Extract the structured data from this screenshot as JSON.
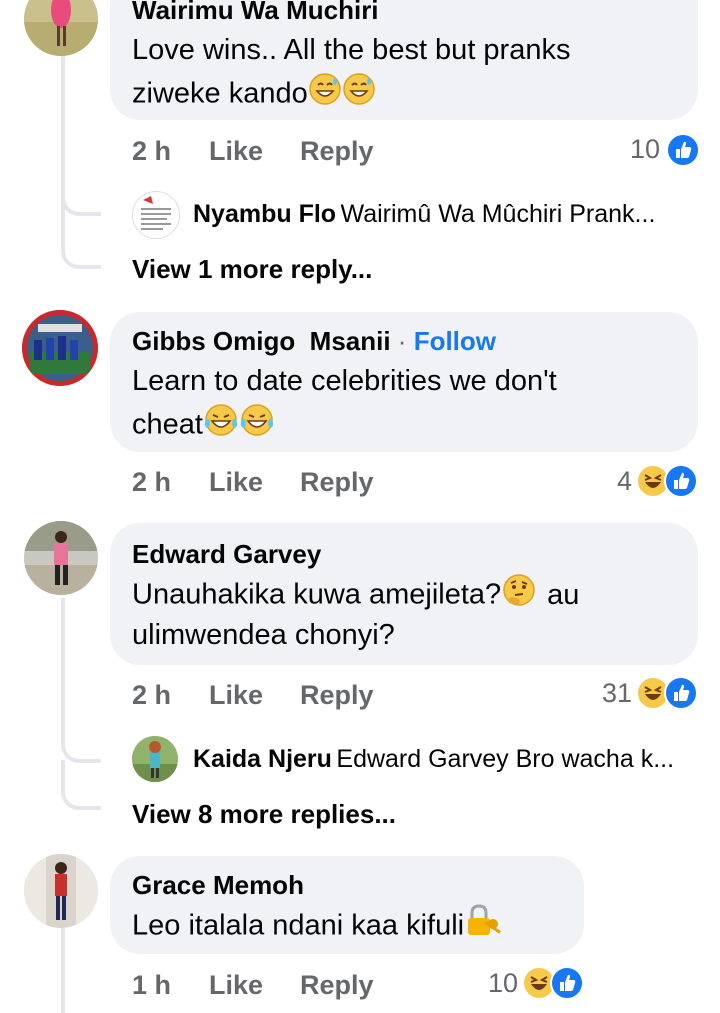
{
  "comments": [
    {
      "name": "Wairimu Wa Muchiri",
      "line1": "Love wins.. All the best but pranks",
      "line2": "ziweke kando",
      "time": "2 h",
      "like": "Like",
      "reply": "Reply",
      "count": "10",
      "reply_preview": {
        "name": "Nyambu Flo",
        "text": "Wairimû Wa Mûchiri Prank..."
      },
      "more": "View 1 more reply..."
    },
    {
      "name": "Gibbs Omigo  Msanii",
      "follow": "Follow",
      "line1": "Learn to date celebrities we don't",
      "line2": "cheat",
      "time": "2 h",
      "like": "Like",
      "reply": "Reply",
      "count": "4"
    },
    {
      "name": "Edward Garvey",
      "line1": "Unauhakika kuwa amejileta?",
      "line1b": "au",
      "line2": "ulimwendea chonyi?",
      "time": "2 h",
      "like": "Like",
      "reply": "Reply",
      "count": "31",
      "reply_preview": {
        "name": "Kaida Njeru",
        "text": "Edward Garvey Bro wacha k..."
      },
      "more": "View 8 more replies..."
    },
    {
      "name": "Grace Memoh",
      "line1": "Leo italala ndani kaa kifuli",
      "time": "1 h",
      "like": "Like",
      "reply": "Reply",
      "count": "10"
    }
  ],
  "colors": {
    "bubble": "#f0f2f5",
    "like_blue": "#1877f2",
    "meta_gray": "#65676b",
    "haha_yellow": "#f7c94b"
  }
}
